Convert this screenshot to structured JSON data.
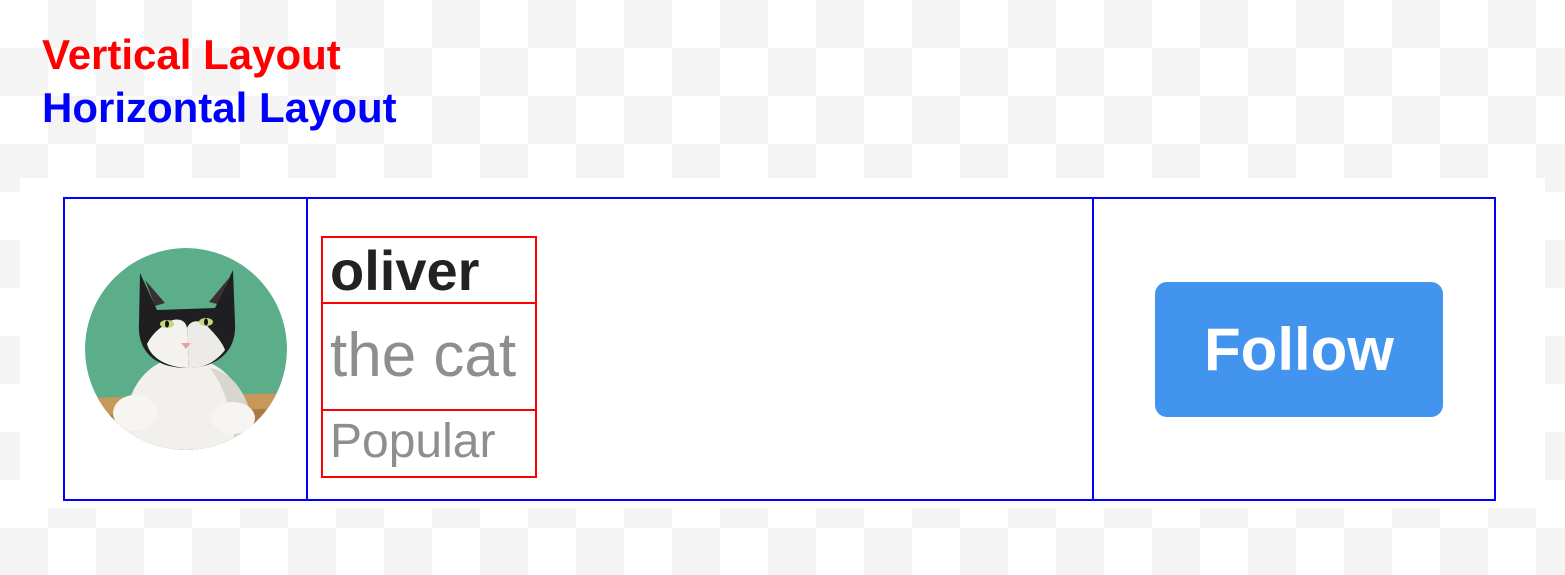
{
  "legend": {
    "vertical_label": "Vertical Layout",
    "horizontal_label": "Horizontal Layout",
    "vertical_color": "#ff0000",
    "horizontal_color": "#0000ff"
  },
  "profile": {
    "avatar_icon": "cat-avatar-icon",
    "name": "oliver",
    "subtitle": "the cat",
    "tag": "Popular"
  },
  "actions": {
    "follow_label": "Follow",
    "follow_color": "#4394ee"
  }
}
